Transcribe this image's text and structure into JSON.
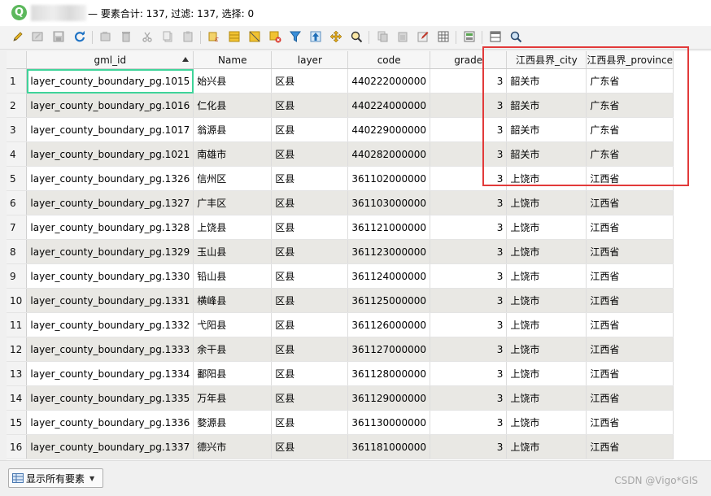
{
  "window": {
    "title": "— 要素合计: 137, 过滤: 137, 选择: 0",
    "logo_letter": "Q"
  },
  "toolbar": {
    "icons": [
      "edit-pencil-icon",
      "multi-edit-icon",
      "save-edits-icon",
      "reload-icon",
      "add-feature-icon",
      "delete-feature-icon",
      "cut-icon",
      "copy-icon",
      "paste-icon",
      "select-by-expression-icon",
      "select-all-icon",
      "invert-selection-icon",
      "deselect-all-icon",
      "filter-select-icon",
      "move-selection-to-top-icon",
      "pan-to-selected-icon",
      "zoom-to-selected-icon",
      "copy-rows-icon",
      "paste-rows-icon",
      "new-field-icon",
      "delete-field-icon",
      "open-field-calculator-icon",
      "conditional-formatting-icon",
      "dock-table-icon",
      "actions-icon"
    ]
  },
  "table": {
    "columns": [
      "gml_id",
      "Name",
      "layer",
      "code",
      "grade",
      "江西县界_city",
      "江西县界_province"
    ],
    "sorted_column": "gml_id",
    "rows": [
      {
        "n": "1",
        "gml_id": "layer_county_boundary_pg.1015",
        "name": "始兴县",
        "layer": "区县",
        "code": "440222000000",
        "grade": "3",
        "city": "韶关市",
        "province": "广东省"
      },
      {
        "n": "2",
        "gml_id": "layer_county_boundary_pg.1016",
        "name": "仁化县",
        "layer": "区县",
        "code": "440224000000",
        "grade": "3",
        "city": "韶关市",
        "province": "广东省"
      },
      {
        "n": "3",
        "gml_id": "layer_county_boundary_pg.1017",
        "name": "翁源县",
        "layer": "区县",
        "code": "440229000000",
        "grade": "3",
        "city": "韶关市",
        "province": "广东省"
      },
      {
        "n": "4",
        "gml_id": "layer_county_boundary_pg.1021",
        "name": "南雄市",
        "layer": "区县",
        "code": "440282000000",
        "grade": "3",
        "city": "韶关市",
        "province": "广东省"
      },
      {
        "n": "5",
        "gml_id": "layer_county_boundary_pg.1326",
        "name": "信州区",
        "layer": "区县",
        "code": "361102000000",
        "grade": "3",
        "city": "上饶市",
        "province": "江西省"
      },
      {
        "n": "6",
        "gml_id": "layer_county_boundary_pg.1327",
        "name": "广丰区",
        "layer": "区县",
        "code": "361103000000",
        "grade": "3",
        "city": "上饶市",
        "province": "江西省"
      },
      {
        "n": "7",
        "gml_id": "layer_county_boundary_pg.1328",
        "name": "上饶县",
        "layer": "区县",
        "code": "361121000000",
        "grade": "3",
        "city": "上饶市",
        "province": "江西省"
      },
      {
        "n": "8",
        "gml_id": "layer_county_boundary_pg.1329",
        "name": "玉山县",
        "layer": "区县",
        "code": "361123000000",
        "grade": "3",
        "city": "上饶市",
        "province": "江西省"
      },
      {
        "n": "9",
        "gml_id": "layer_county_boundary_pg.1330",
        "name": "铅山县",
        "layer": "区县",
        "code": "361124000000",
        "grade": "3",
        "city": "上饶市",
        "province": "江西省"
      },
      {
        "n": "10",
        "gml_id": "layer_county_boundary_pg.1331",
        "name": "横峰县",
        "layer": "区县",
        "code": "361125000000",
        "grade": "3",
        "city": "上饶市",
        "province": "江西省"
      },
      {
        "n": "11",
        "gml_id": "layer_county_boundary_pg.1332",
        "name": "弋阳县",
        "layer": "区县",
        "code": "361126000000",
        "grade": "3",
        "city": "上饶市",
        "province": "江西省"
      },
      {
        "n": "12",
        "gml_id": "layer_county_boundary_pg.1333",
        "name": "余干县",
        "layer": "区县",
        "code": "361127000000",
        "grade": "3",
        "city": "上饶市",
        "province": "江西省"
      },
      {
        "n": "13",
        "gml_id": "layer_county_boundary_pg.1334",
        "name": "鄱阳县",
        "layer": "区县",
        "code": "361128000000",
        "grade": "3",
        "city": "上饶市",
        "province": "江西省"
      },
      {
        "n": "14",
        "gml_id": "layer_county_boundary_pg.1335",
        "name": "万年县",
        "layer": "区县",
        "code": "361129000000",
        "grade": "3",
        "city": "上饶市",
        "province": "江西省"
      },
      {
        "n": "15",
        "gml_id": "layer_county_boundary_pg.1336",
        "name": "婺源县",
        "layer": "区县",
        "code": "361130000000",
        "grade": "3",
        "city": "上饶市",
        "province": "江西省"
      },
      {
        "n": "16",
        "gml_id": "layer_county_boundary_pg.1337",
        "name": "德兴市",
        "layer": "区县",
        "code": "361181000000",
        "grade": "3",
        "city": "上饶市",
        "province": "江西省"
      }
    ]
  },
  "footer": {
    "show_all_label": "显示所有要素",
    "watermark": "CSDN @Vigo*GIS"
  },
  "colors": {
    "highlight_box": "#e23a3a",
    "selected_cell_outline": "#3fd49a",
    "alt_row": "#e9e8e4"
  }
}
